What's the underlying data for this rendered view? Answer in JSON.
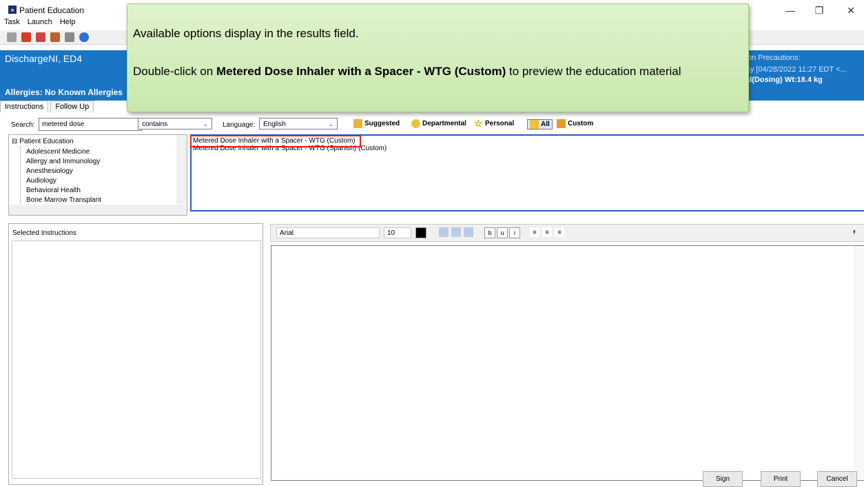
{
  "window": {
    "title": "Patient Education",
    "minimize": "—",
    "restore": "❐",
    "close": "✕"
  },
  "menu": [
    "Task",
    "Launch",
    "Help"
  ],
  "banner": {
    "patient_name": "DischargeNI, ED4",
    "allergies": "Allergies: No Known Allergies",
    "right_line1": "on Precautions:",
    "right_line2": "ency [04/28/2022 11:27 EDT <...",
    "right_line3": "al(Dosing) Wt:18.4 kg"
  },
  "tabs": [
    "Instructions",
    "Follow Up"
  ],
  "search": {
    "label": "Search:",
    "value": "metered dose",
    "match_mode": "contains"
  },
  "language": {
    "label": "Language:",
    "value": "English"
  },
  "filters": [
    "Suggested",
    "Departmental",
    "Personal",
    "All",
    "Custom"
  ],
  "tree": {
    "root": "Patient Education",
    "children": [
      "Adolescent Medicine",
      "Allergy and Immunology",
      "Anesthesiology",
      "Audiology",
      "Behavioral Health",
      "Bone Marrow Transplant"
    ]
  },
  "results": [
    "Metered Dose Inhaler with a Spacer - WTG (Custom)",
    "Metered Dose Inhaler with a Spacer - WTG (Spanish) (Custom)"
  ],
  "selected_instructions_label": "Selected Instructions",
  "editor": {
    "font": "Arial",
    "size": "10"
  },
  "buttons": {
    "sign": "Sign",
    "print": "Print",
    "cancel": "Cancel"
  },
  "callout": {
    "line1": "Available options display in the results field.",
    "line2_prefix": "Double-click on ",
    "line2_bold": "Metered Dose Inhaler with a Spacer - WTG (Custom)",
    "line2_suffix": " to preview the education material"
  }
}
